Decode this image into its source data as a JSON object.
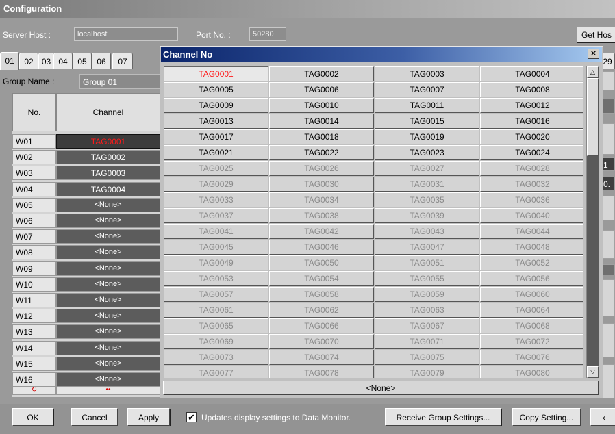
{
  "window": {
    "title": "Configuration",
    "server_host_label": "Server Host :",
    "server_host_value": "localhost",
    "port_label": "Port No. :",
    "port_value": "50280",
    "get_host_label": "Get Hos"
  },
  "tabs": [
    "01",
    "02",
    "03",
    "04",
    "05",
    "06",
    "07"
  ],
  "tab_right_partial": "29",
  "group": {
    "label": "Group Name :",
    "value": "Group 01"
  },
  "table": {
    "col_no": "No.",
    "col_channel": "Channel",
    "rows": [
      {
        "no": "W01",
        "channel": "TAG0001"
      },
      {
        "no": "W02",
        "channel": "TAG0002"
      },
      {
        "no": "W03",
        "channel": "TAG0003"
      },
      {
        "no": "W04",
        "channel": "TAG0004"
      },
      {
        "no": "W05",
        "channel": "<None>"
      },
      {
        "no": "W06",
        "channel": "<None>"
      },
      {
        "no": "W07",
        "channel": "<None>"
      },
      {
        "no": "W08",
        "channel": "<None>"
      },
      {
        "no": "W09",
        "channel": "<None>"
      },
      {
        "no": "W10",
        "channel": "<None>"
      },
      {
        "no": "W11",
        "channel": "<None>"
      },
      {
        "no": "W12",
        "channel": "<None>"
      },
      {
        "no": "W13",
        "channel": "<None>"
      },
      {
        "no": "W14",
        "channel": "<None>"
      },
      {
        "no": "W15",
        "channel": "<None>"
      },
      {
        "no": "W16",
        "channel": "<None>"
      }
    ],
    "footer_icon": "refresh-icon",
    "footer_mark": "••"
  },
  "right_partial_values": [
    "1",
    "0."
  ],
  "bottom": {
    "ok_label": "OK",
    "cancel_label": "Cancel",
    "apply_label": "Apply",
    "checkbox_label": "Updates display settings to Data Monitor.",
    "checkbox_checked": true,
    "receive_label": "Receive Group Settings...",
    "copy_label": "Copy Setting...",
    "partial_label": "‹"
  },
  "dialog": {
    "title": "Channel No",
    "close_icon": "close-icon",
    "selected_tag": "TAG0001",
    "enabled_count": 24,
    "tags": [
      "TAG0001",
      "TAG0002",
      "TAG0003",
      "TAG0004",
      "TAG0005",
      "TAG0006",
      "TAG0007",
      "TAG0008",
      "TAG0009",
      "TAG0010",
      "TAG0011",
      "TAG0012",
      "TAG0013",
      "TAG0014",
      "TAG0015",
      "TAG0016",
      "TAG0017",
      "TAG0018",
      "TAG0019",
      "TAG0020",
      "TAG0021",
      "TAG0022",
      "TAG0023",
      "TAG0024",
      "TAG0025",
      "TAG0026",
      "TAG0027",
      "TAG0028",
      "TAG0029",
      "TAG0030",
      "TAG0031",
      "TAG0032",
      "TAG0033",
      "TAG0034",
      "TAG0035",
      "TAG0036",
      "TAG0037",
      "TAG0038",
      "TAG0039",
      "TAG0040",
      "TAG0041",
      "TAG0042",
      "TAG0043",
      "TAG0044",
      "TAG0045",
      "TAG0046",
      "TAG0047",
      "TAG0048",
      "TAG0049",
      "TAG0050",
      "TAG0051",
      "TAG0052",
      "TAG0053",
      "TAG0054",
      "TAG0055",
      "TAG0056",
      "TAG0057",
      "TAG0058",
      "TAG0059",
      "TAG0060",
      "TAG0061",
      "TAG0062",
      "TAG0063",
      "TAG0064",
      "TAG0065",
      "TAG0066",
      "TAG0067",
      "TAG0068",
      "TAG0069",
      "TAG0070",
      "TAG0071",
      "TAG0072",
      "TAG0073",
      "TAG0074",
      "TAG0075",
      "TAG0076",
      "TAG0077",
      "TAG0078",
      "TAG0079",
      "TAG0080"
    ],
    "none_label": "<None>",
    "scroll_up_icon": "triangle-up-icon",
    "scroll_down_icon": "triangle-down-icon"
  },
  "colors": {
    "selected_text": "#ff1a1a",
    "dialog_title_start": "#0a246a",
    "dialog_title_end": "#a6caf0",
    "disabled_text": "#8a8a8a"
  }
}
